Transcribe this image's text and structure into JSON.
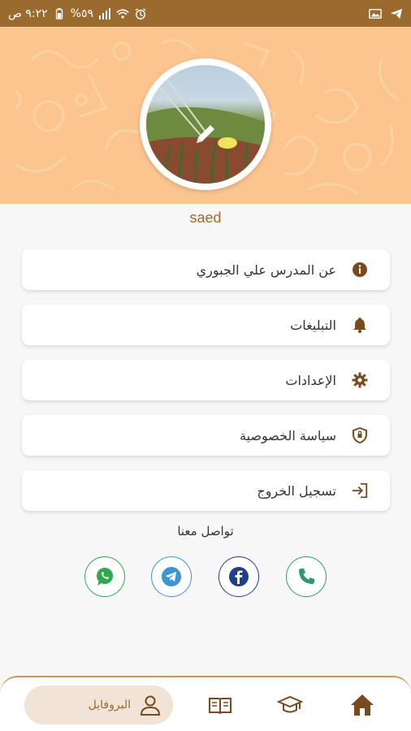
{
  "status_bar": {
    "time": "٩:٢٢ ص",
    "battery": "%٥٩",
    "icons": [
      "telegram-icon",
      "image-icon",
      "alarm-icon",
      "wifi-icon",
      "signal-icon",
      "battery-icon"
    ]
  },
  "profile": {
    "username": "saed",
    "avatar_icon": "avatar-photo",
    "edit_icon": "pencil-icon"
  },
  "menu": {
    "items": [
      {
        "label": "عن المدرس علي الجبوري",
        "icon": "info-icon"
      },
      {
        "label": "التبليغات",
        "icon": "bell-icon"
      },
      {
        "label": "الإعدادات",
        "icon": "gear-icon"
      },
      {
        "label": "سياسة الخصوصية",
        "icon": "shield-icon"
      },
      {
        "label": "تسجيل الخروج",
        "icon": "logout-icon"
      }
    ]
  },
  "contact": {
    "title": "تواصل معنا",
    "channels": [
      "whatsapp-icon",
      "telegram-icon",
      "facebook-icon",
      "phone-icon"
    ]
  },
  "bottom_nav": {
    "profile_label": "البروفايل",
    "items": [
      "profile-icon",
      "book-icon",
      "graduation-cap-icon",
      "home-icon"
    ]
  },
  "colors": {
    "brand": "#9a6a2f",
    "header_bg": "#fcc48f",
    "whatsapp": "#2fa84f",
    "telegram": "#3d95d3",
    "facebook": "#1f3e8c",
    "phone": "#2e9a6c"
  }
}
